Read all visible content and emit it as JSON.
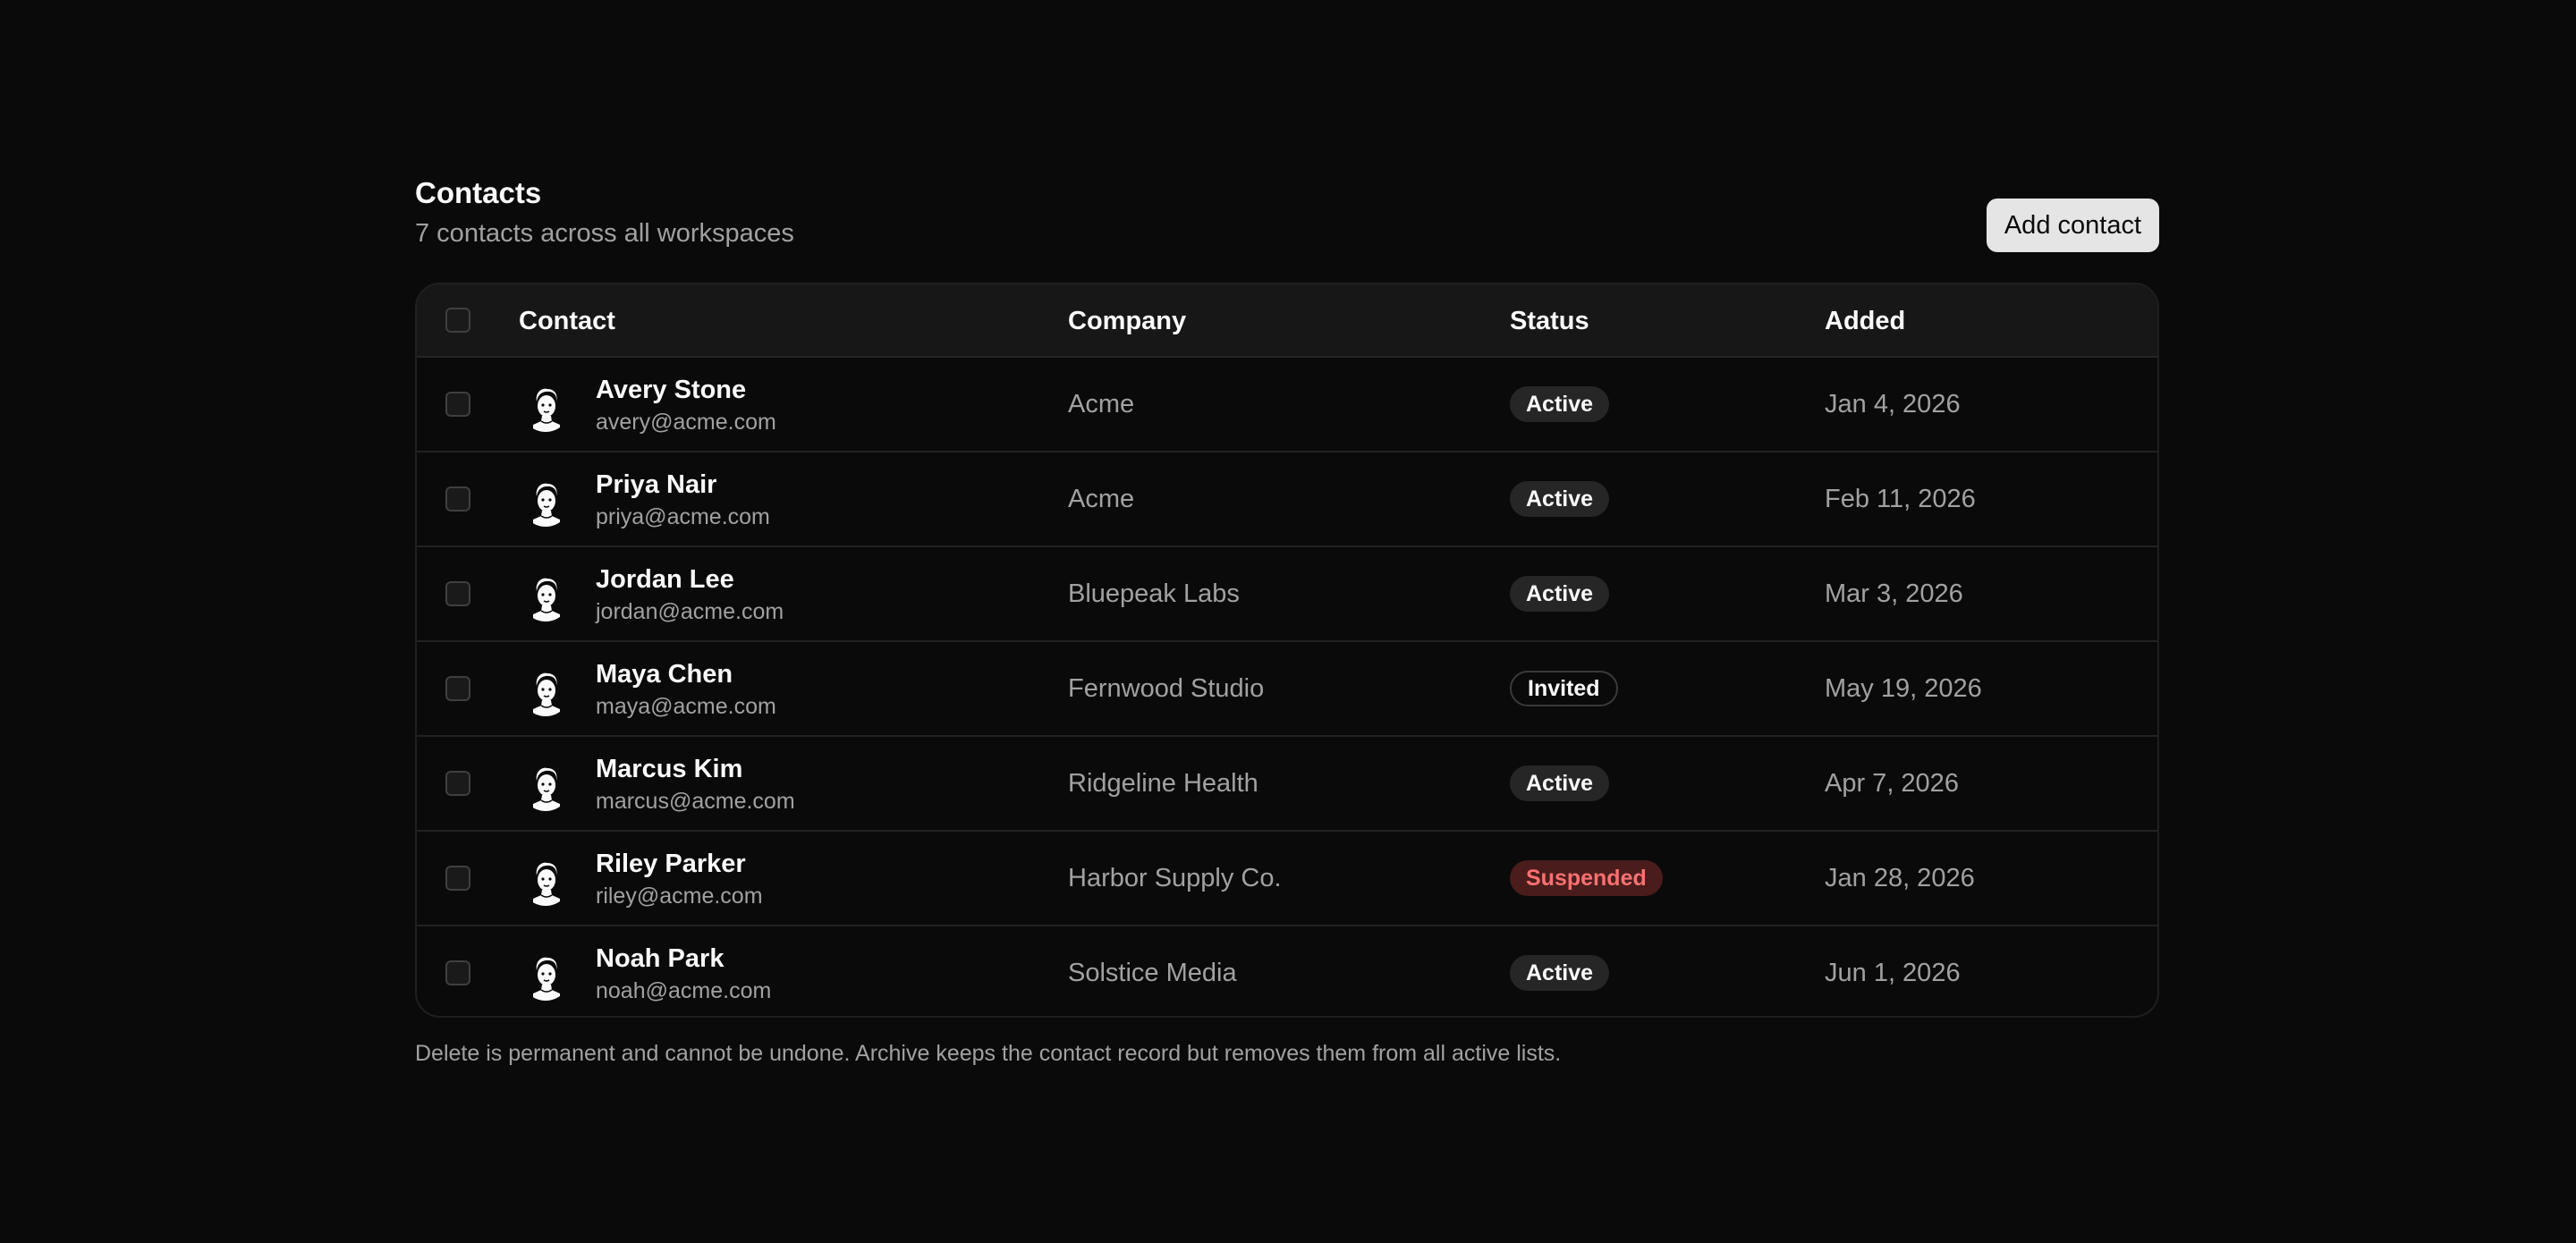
{
  "header": {
    "title": "Contacts",
    "subtitle": "7 contacts across all workspaces",
    "add_button": "Add contact"
  },
  "table": {
    "columns": [
      "Contact",
      "Company",
      "Status",
      "Added"
    ],
    "rows": [
      {
        "name": "Avery Stone",
        "email": "avery@acme.com",
        "company": "Acme",
        "status": "Active",
        "added": "Jan 4, 2026"
      },
      {
        "name": "Priya Nair",
        "email": "priya@acme.com",
        "company": "Acme",
        "status": "Active",
        "added": "Feb 11, 2026"
      },
      {
        "name": "Jordan Lee",
        "email": "jordan@acme.com",
        "company": "Bluepeak Labs",
        "status": "Active",
        "added": "Mar 3, 2026"
      },
      {
        "name": "Maya Chen",
        "email": "maya@acme.com",
        "company": "Fernwood Studio",
        "status": "Invited",
        "added": "May 19, 2026"
      },
      {
        "name": "Marcus Kim",
        "email": "marcus@acme.com",
        "company": "Ridgeline Health",
        "status": "Active",
        "added": "Apr 7, 2026"
      },
      {
        "name": "Riley Parker",
        "email": "riley@acme.com",
        "company": "Harbor Supply Co.",
        "status": "Suspended",
        "added": "Jan 28, 2026"
      },
      {
        "name": "Noah Park",
        "email": "noah@acme.com",
        "company": "Solstice Media",
        "status": "Active",
        "added": "Jun 1, 2026"
      }
    ]
  },
  "footnote": "Delete is permanent and cannot be undone. Archive keeps the contact record but removes them from all active lists.",
  "colors": {
    "background": "#0a0a0a",
    "header_row": "#171717",
    "active_badge": "#262626",
    "suspended_badge_bg": "#4a1c1c",
    "suspended_badge_text": "#f87171"
  },
  "icons": {
    "avatar": "avatar-illustration-icon",
    "checkbox": "checkbox-unchecked"
  }
}
